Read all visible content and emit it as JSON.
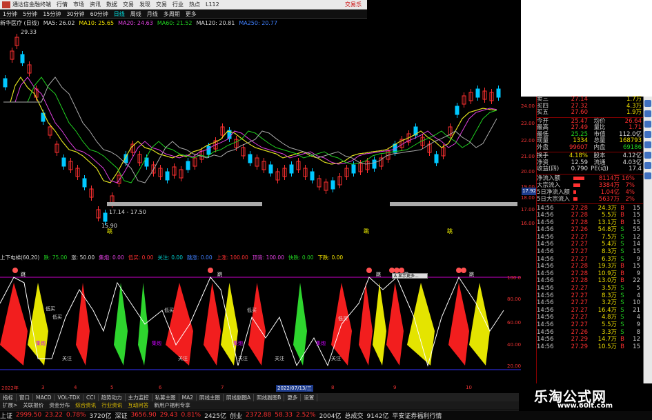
{
  "titlebar": {
    "app": "通达信金融终端",
    "menus": [
      "行情",
      "市场",
      "资讯",
      "数据",
      "交易",
      "发现",
      "交易",
      "行业",
      "热点"
    ],
    "code_label": "L112",
    "right_label": "交易乐"
  },
  "toolbar": {
    "items": [
      "1分钟",
      "5分钟",
      "15分钟",
      "30分钟",
      "60分钟",
      "日线",
      "周线",
      "月线",
      "多周期",
      "更多"
    ],
    "active": "日线"
  },
  "mabar": {
    "name": "新华医疗 (日线)",
    "ma5": "MA5: 26.02",
    "ma10": "MA10: 25.65",
    "ma20": "MA20: 24.63",
    "ma60": "MA60: 21.52",
    "ma120": "MA120: 20.81",
    "ma250": "MA250: 20.77"
  },
  "main_chart": {
    "high_label": "29.33",
    "low_label": "15.90",
    "range_label": "17.14 - 17.50",
    "axis": [
      "24.00",
      "23.00",
      "22.00",
      "21.00",
      "20.00",
      "19.00",
      "18.00",
      "17.00",
      "16.00"
    ],
    "current_tag": "17.92",
    "markers": [
      "跳",
      "跳",
      "跳"
    ]
  },
  "indicator_bar": {
    "name": "上下电梯(60,20)",
    "items": [
      {
        "t": "跌: 75.00",
        "c": "g"
      },
      {
        "t": "涨: 50.00",
        "c": "w"
      },
      {
        "t": "集炮: 0.00",
        "c": "m"
      },
      {
        "t": "低买: 0.00",
        "c": "r"
      },
      {
        "t": "关注: 0.00",
        "c": "c"
      },
      {
        "t": "跳涨: 0.00",
        "c": "b"
      },
      {
        "t": "上涨: 100.00",
        "c": "r"
      },
      {
        "t": "顶背: 100.00",
        "c": "m"
      },
      {
        "t": "快跌: 0.00",
        "c": "g"
      },
      {
        "t": "下跌: 0.00",
        "c": "y"
      }
    ]
  },
  "ind_labels": {
    "axis": [
      "100.00",
      "80.00",
      "60.00",
      "40.00",
      "20.00"
    ],
    "labels": [
      "低买",
      "低买",
      "低买",
      "低买",
      "低买",
      "关注",
      "关注",
      "关注",
      "关注",
      "关注",
      "跳",
      "跳",
      "跳",
      "跳",
      "跳",
      "集炮",
      "集炮",
      "集炮",
      "集炮"
    ],
    "dialog": "A 显示更多..."
  },
  "datebar": {
    "items": [
      "2022年",
      "3",
      "4",
      "5",
      "6",
      "7",
      "8",
      "9",
      "10"
    ],
    "current": "2022/07/13/三"
  },
  "tabs": [
    "指标",
    "窗口",
    "MACD",
    "VOL-TDX",
    "CCI",
    "趋势动力",
    "主力监控",
    "私募主图",
    "MA2",
    "阴线主图",
    "阴线副图A",
    "阴线副图B",
    "更多",
    "设置"
  ],
  "tabs2": [
    "扩展>",
    "关联报价",
    "资金分布",
    "综合资讯",
    "行业资讯",
    "互动问答",
    "新用户福利专享"
  ],
  "status": {
    "sh_label": "上证",
    "sh": "2999.50",
    "sh_chg": "23.22",
    "sh_pct": "0.78%",
    "sh_amt": "3720亿",
    "sz_label": "深证",
    "sz": "3656.90",
    "sz_chg": "29.43",
    "sz_pct": "0.81%",
    "sz_amt": "2425亿",
    "cy_label": "创业",
    "cy": "2372.88",
    "cy_chg": "58.33",
    "cy_pct": "2.52%",
    "cy_amt": "2004亿",
    "total_label": "总成交",
    "total": "9142亿",
    "news": "平安证券福利行情"
  },
  "quote": {
    "asks": [
      {
        "l": "卖三",
        "p": "27.14",
        "v": "1.7万"
      },
      {
        "l": "买四",
        "p": "27.32",
        "v": "4.3万"
      },
      {
        "l": "买五",
        "p": "27.60",
        "v": "1.9万"
      }
    ],
    "stats": [
      {
        "a": "今开",
        "av": "25.47",
        "ac": "r",
        "b": "均价",
        "bv": "26.64",
        "bc": "r"
      },
      {
        "a": "最高",
        "av": "27.49",
        "ac": "r",
        "b": "量比",
        "bv": "1.71",
        "bc": "r"
      },
      {
        "a": "最低",
        "av": "25.25",
        "ac": "g",
        "b": "市值",
        "bv": "112.0亿",
        "bc": "w"
      },
      {
        "a": "现量",
        "av": "1334",
        "ac": "y",
        "b": "总量",
        "bv": "168793",
        "bc": "y"
      },
      {
        "a": "外盘",
        "av": "99607",
        "ac": "r",
        "b": "内盘",
        "bv": "69186",
        "bc": "g"
      }
    ],
    "stats2": [
      {
        "a": "换手",
        "av": "4.18%",
        "ac": "y",
        "b": "股本",
        "bv": "4.12亿",
        "bc": "w"
      },
      {
        "a": "净资",
        "av": "12.59",
        "ac": "w",
        "b": "流通",
        "bv": "4.03亿",
        "bc": "w"
      },
      {
        "a": "收益(四)",
        "av": "0.790",
        "ac": "w",
        "b": "PE(动)",
        "bv": "17.4",
        "bc": "w"
      }
    ],
    "flows": [
      {
        "l": "净流入额",
        "w": 16,
        "v": "8114万",
        "p": "16%"
      },
      {
        "l": "大宗流入",
        "w": 10,
        "v": "3384万",
        "p": "7%"
      },
      {
        "l": "5日净流入额",
        "w": 4,
        "v": "1.04亿",
        "p": "4%"
      },
      {
        "l": "5日大宗流入",
        "w": 6,
        "v": "5637万",
        "p": "2%"
      }
    ],
    "ticks": [
      {
        "t": "14:56",
        "p": "27.28",
        "v": "24.3万",
        "s": "B",
        "n": "15"
      },
      {
        "t": "14:56",
        "p": "27.28",
        "v": "5.5万",
        "s": "B",
        "n": "15"
      },
      {
        "t": "14:56",
        "p": "27.28",
        "v": "13.1万",
        "s": "B",
        "n": "15"
      },
      {
        "t": "14:56",
        "p": "27.26",
        "v": "54.8万",
        "s": "S",
        "n": "55"
      },
      {
        "t": "14:56",
        "p": "27.27",
        "v": "7.5万",
        "s": "S",
        "n": "12"
      },
      {
        "t": "14:56",
        "p": "27.27",
        "v": "5.4万",
        "s": "S",
        "n": "14"
      },
      {
        "t": "14:56",
        "p": "27.27",
        "v": "8.3万",
        "s": "S",
        "n": "15"
      },
      {
        "t": "14:56",
        "p": "27.27",
        "v": "6.3万",
        "s": "S",
        "n": "9"
      },
      {
        "t": "14:56",
        "p": "27.28",
        "v": "19.3万",
        "s": "B",
        "n": "15"
      },
      {
        "t": "14:56",
        "p": "27.28",
        "v": "10.9万",
        "s": "B",
        "n": "9"
      },
      {
        "t": "14:56",
        "p": "27.28",
        "v": "13.0万",
        "s": "B",
        "n": "22"
      },
      {
        "t": "14:56",
        "p": "27.27",
        "v": "3.5万",
        "s": "S",
        "n": "5"
      },
      {
        "t": "14:56",
        "p": "27.27",
        "v": "8.3万",
        "s": "S",
        "n": "4"
      },
      {
        "t": "14:56",
        "p": "27.27",
        "v": "3.2万",
        "s": "S",
        "n": "10"
      },
      {
        "t": "14:56",
        "p": "27.27",
        "v": "16.4万",
        "s": "S",
        "n": "21"
      },
      {
        "t": "14:56",
        "p": "27.27",
        "v": "4.8万",
        "s": "S",
        "n": "4"
      },
      {
        "t": "14:56",
        "p": "27.27",
        "v": "5.5万",
        "s": "S",
        "n": "9"
      },
      {
        "t": "14:56",
        "p": "27.26",
        "v": "3.3万",
        "s": "S",
        "n": "8"
      },
      {
        "t": "14:56",
        "p": "27.29",
        "v": "14.7万",
        "s": "B",
        "n": "12"
      },
      {
        "t": "14:56",
        "p": "27.29",
        "v": "10.5万",
        "s": "B",
        "n": "15"
      }
    ]
  },
  "watermark": {
    "title": "乐淘公式网",
    "url": "www.60lt.com"
  }
}
